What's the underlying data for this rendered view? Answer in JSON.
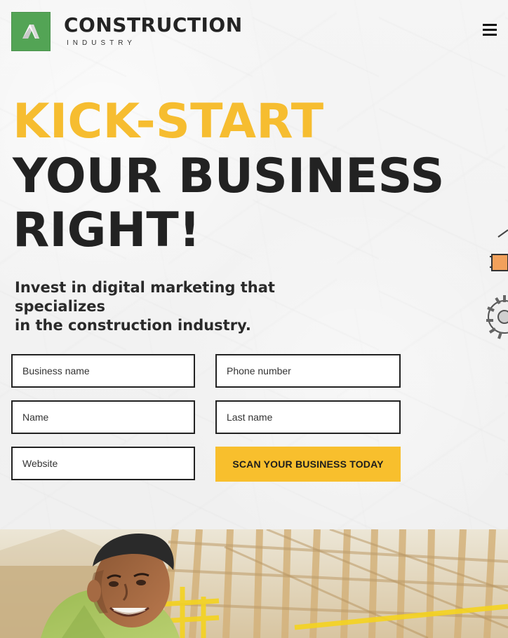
{
  "header": {
    "brand_title": "CONSTRUCTION",
    "brand_subtitle": "INDUSTRY",
    "logo_icon": "building-logo-icon",
    "menu_icon": "hamburger-menu-icon"
  },
  "hero": {
    "line1": "KICK-START",
    "line2": "YOUR BUSINESS",
    "line3": "RIGHT!",
    "intro_line1": "Invest in digital marketing that specializes",
    "intro_line2": "in the construction industry."
  },
  "form": {
    "business_name_placeholder": "Business name",
    "phone_number_placeholder": "Phone number",
    "name_placeholder": "Name",
    "last_name_placeholder": "Last name",
    "website_placeholder": "Website",
    "submit_label": "SCAN YOUR BUSINESS TODAY"
  },
  "colors": {
    "accent_yellow": "#f8bf2d",
    "logo_green": "#53a455",
    "text_dark": "#222222"
  },
  "decor": {
    "right_art_icon": "construction-gear-icon",
    "photo_subject": "smiling-worker-image"
  }
}
